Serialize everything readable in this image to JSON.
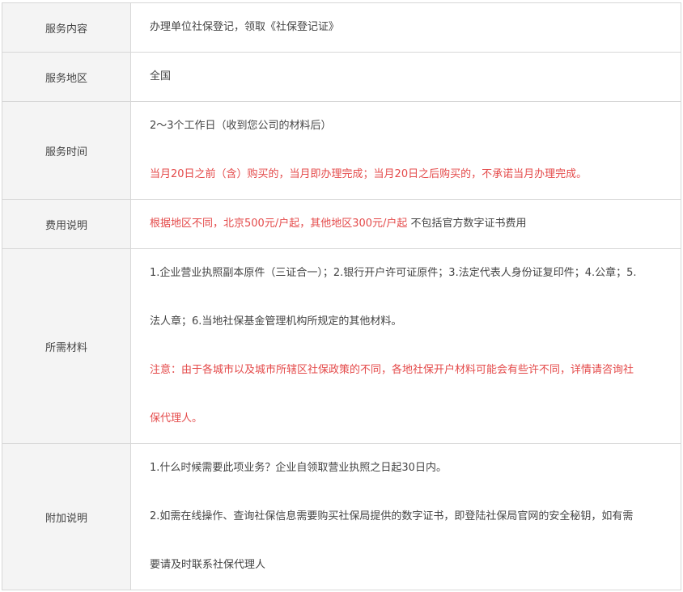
{
  "rows": [
    {
      "label": "服务内容",
      "lines": [
        {
          "text": "办理单位社保登记，领取《社保登记证》"
        }
      ]
    },
    {
      "label": "服务地区",
      "lines": [
        {
          "text": "全国"
        }
      ]
    },
    {
      "label": "服务时间",
      "line1": "2～3个工作日（收到您公司的材料后）",
      "line2": "当月20日之前（含）购买的，当月即办理完成；当月20日之后购买的，不承诺当月办理完成。"
    },
    {
      "label": "费用说明",
      "red_text": "根据地区不同，北京500元/户起，其他地区300元/户起",
      "dark_text": " 不包括官方数字证书费用"
    },
    {
      "label": "所需材料",
      "line1": "1.企业营业执照副本原件（三证合一）；2.银行开户许可证原件；3.法定代表人身份证复印件；4.公章；5.",
      "line2": "法人章；6.当地社保基金管理机构所规定的其他材料。",
      "line3": "注意：由于各城市以及城市所辖区社保政策的不同，各地社保开户材料可能会有些许不同，详情请咨询社",
      "line4": "保代理人。"
    },
    {
      "label": "附加说明",
      "line1": "1.什么时候需要此项业务？企业自领取营业执照之日起30日内。",
      "line2": "2.如需在线操作、查询社保信息需要购买社保局提供的数字证书，即登陆社保局官网的安全秘钥，如有需",
      "line3": "要请及时联系社保代理人"
    }
  ],
  "colors": {
    "label_bg": "#f4f4f4",
    "border": "#d7d7d7",
    "text": "#444444",
    "highlight": "#e44a4a"
  }
}
